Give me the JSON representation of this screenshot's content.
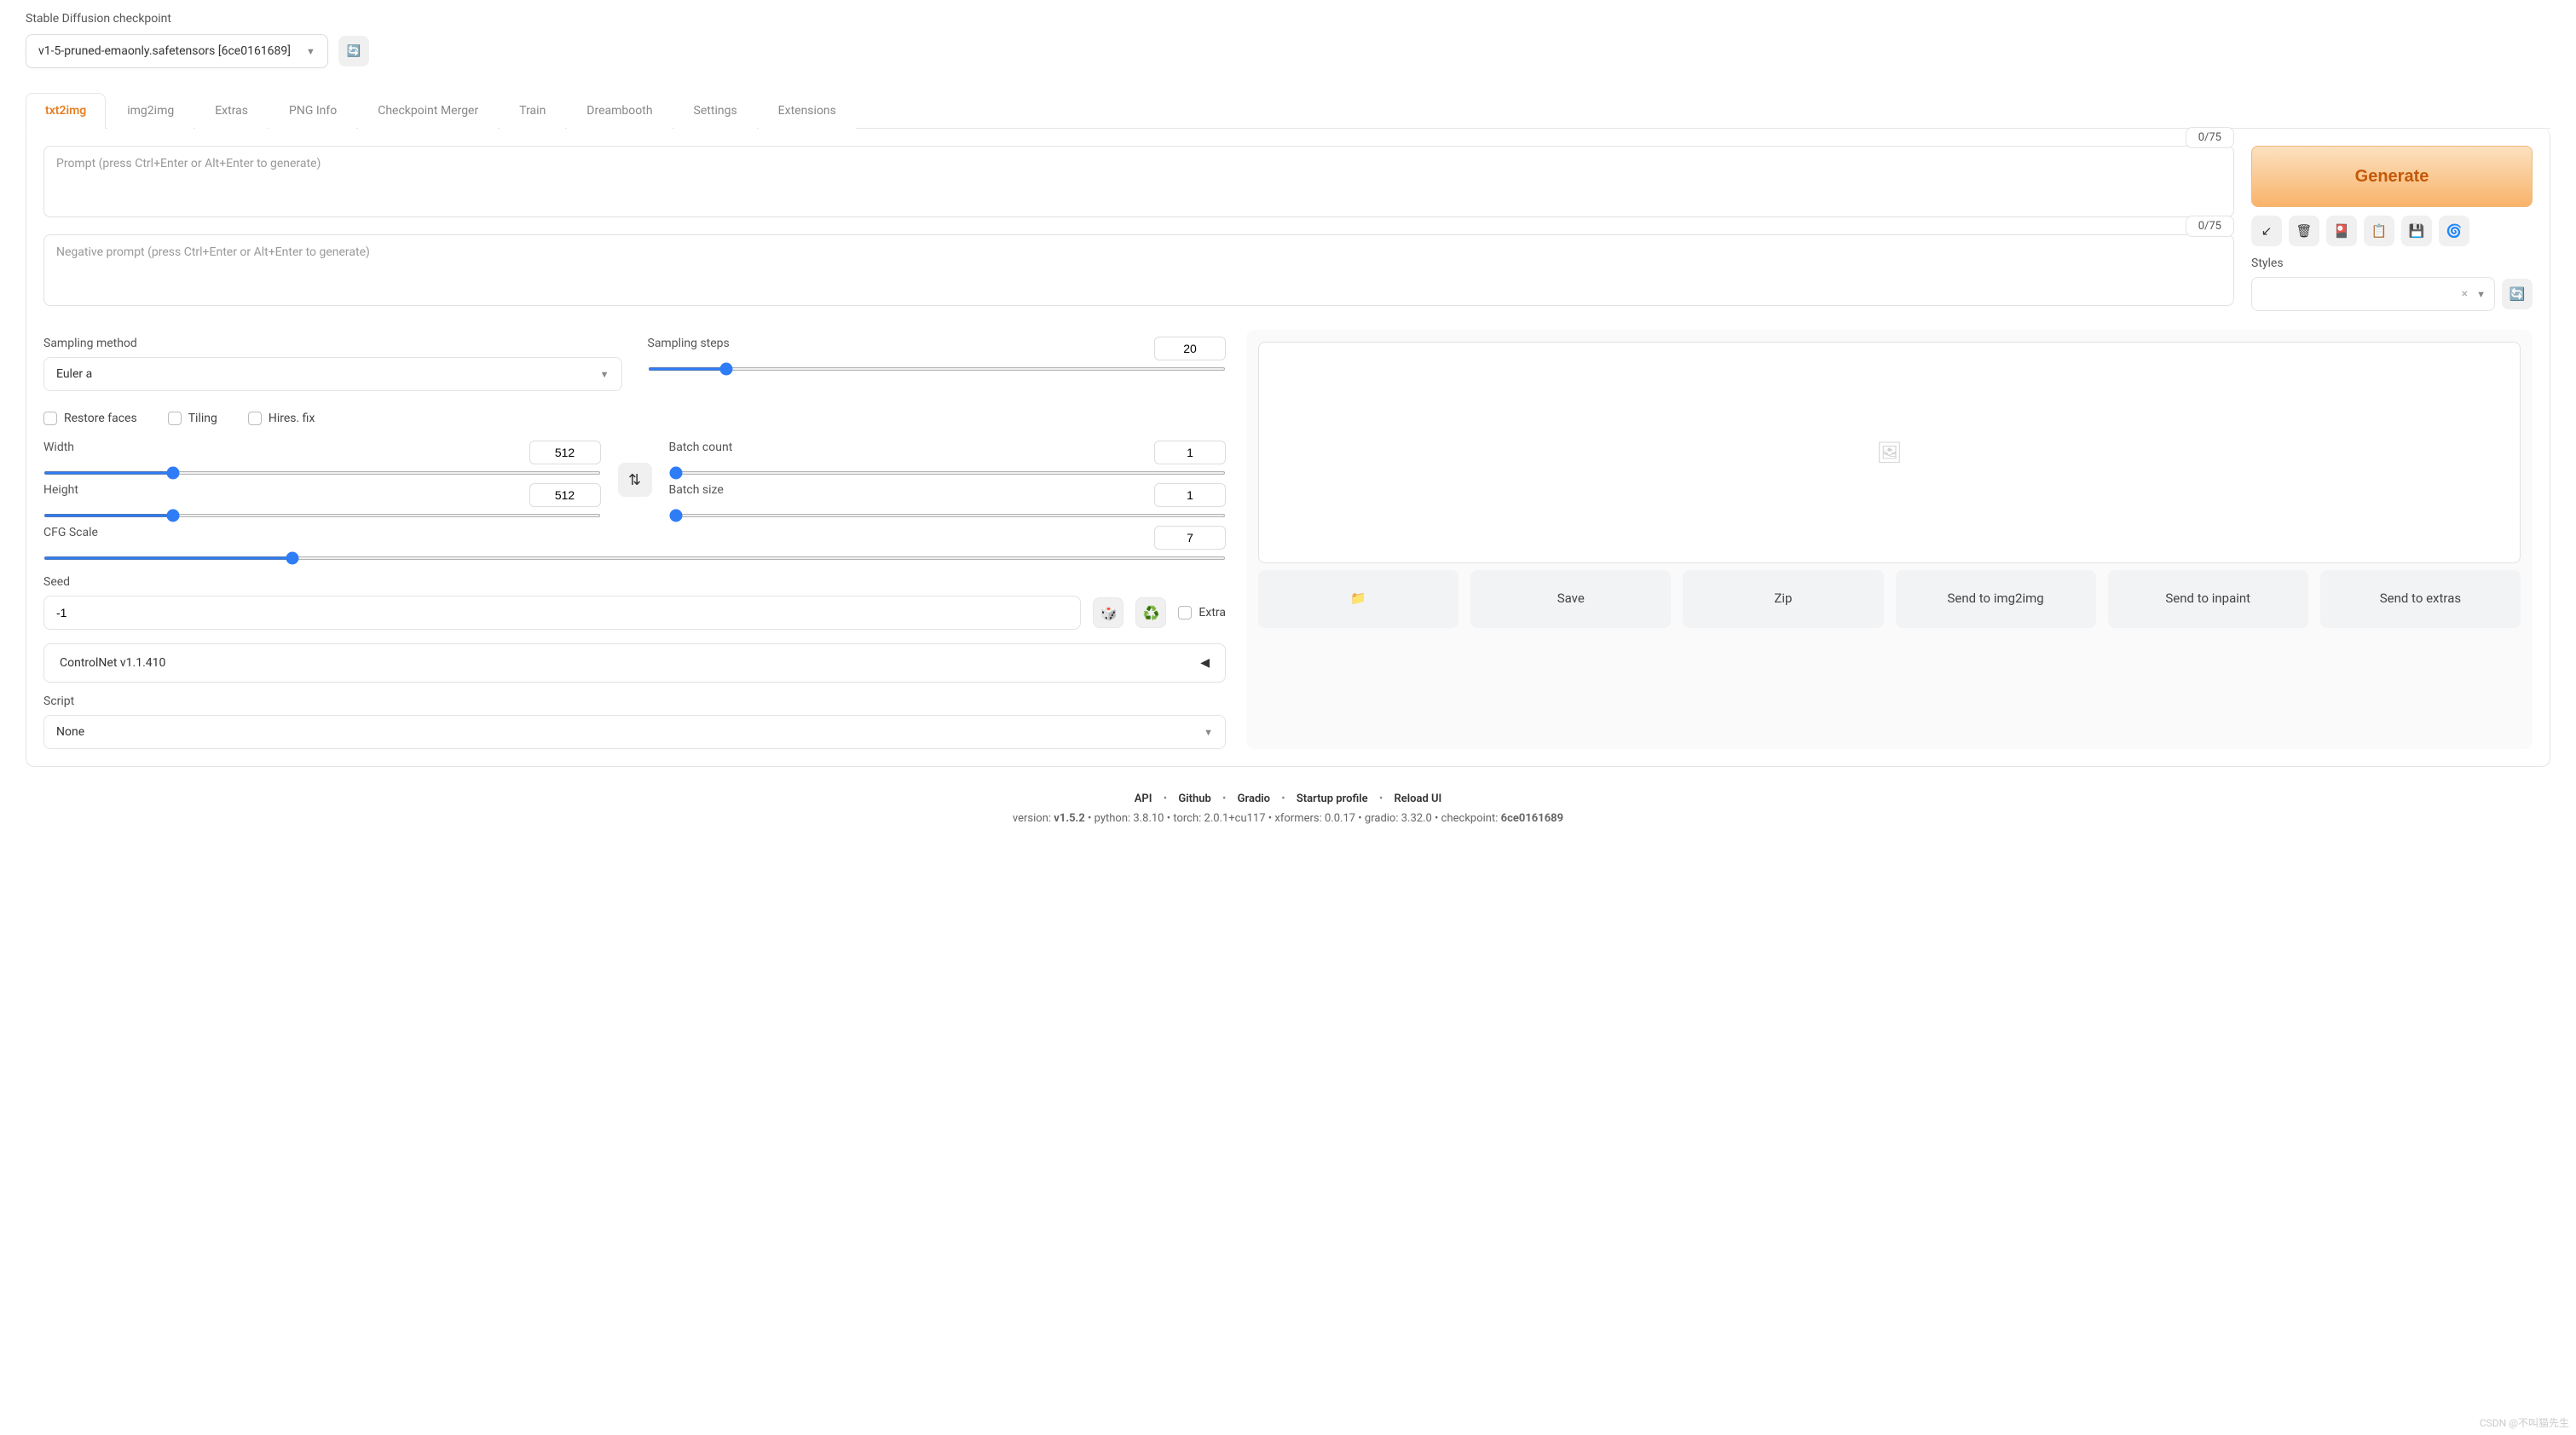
{
  "checkpoint": {
    "label": "Stable Diffusion checkpoint",
    "value": "v1-5-pruned-emaonly.safetensors [6ce0161689]"
  },
  "tabs": {
    "items": [
      "txt2img",
      "img2img",
      "Extras",
      "PNG Info",
      "Checkpoint Merger",
      "Train",
      "Dreambooth",
      "Settings",
      "Extensions"
    ],
    "active": 0
  },
  "prompt": {
    "placeholder": "Prompt (press Ctrl+Enter or Alt+Enter to generate)",
    "counter": "0/75"
  },
  "neg_prompt": {
    "placeholder": "Negative prompt (press Ctrl+Enter or Alt+Enter to generate)",
    "counter": "0/75"
  },
  "generate": {
    "label": "Generate"
  },
  "styles": {
    "label": "Styles",
    "clear": "×"
  },
  "sampling": {
    "method_label": "Sampling method",
    "method_value": "Euler a",
    "steps_label": "Sampling steps",
    "steps_value": "20",
    "steps_min": 1,
    "steps_max": 150
  },
  "checks": {
    "restore": "Restore faces",
    "tiling": "Tiling",
    "hires": "Hires. fix"
  },
  "dims": {
    "width_label": "Width",
    "width_value": "512",
    "height_label": "Height",
    "height_value": "512",
    "min": 64,
    "max": 2048,
    "swap": "⇅"
  },
  "batch": {
    "count_label": "Batch count",
    "count_value": "1",
    "size_label": "Batch size",
    "size_value": "1",
    "min": 1,
    "max": 100
  },
  "cfg": {
    "label": "CFG Scale",
    "value": "7",
    "min": 1,
    "max": 30
  },
  "seed": {
    "label": "Seed",
    "value": "-1",
    "dice": "🎲",
    "recycle": "♻️",
    "extra_label": "Extra"
  },
  "controlnet": {
    "title": "ControlNet v1.1.410",
    "arrow": "◀"
  },
  "script": {
    "label": "Script",
    "value": "None"
  },
  "output_buttons": {
    "folder": "📁",
    "save": "Save",
    "zip": "Zip",
    "send_img2img": "Send to img2img",
    "send_inpaint": "Send to inpaint",
    "send_extras": "Send to extras"
  },
  "icons": {
    "paste": "↙",
    "trash": "🗑",
    "card": "🎴",
    "clipboard": "📋",
    "save": "💾",
    "spiral": "🌀",
    "refresh": "🔄",
    "image_placeholder": "🖼"
  },
  "footer": {
    "links": {
      "api": "API",
      "github": "Github",
      "gradio": "Gradio",
      "startup": "Startup profile",
      "reload": "Reload UI",
      "sep": "•"
    },
    "ver": {
      "prefix": "version: ",
      "version": "v1.5.2",
      "python": "python: 3.8.10",
      "torch": "torch: 2.0.1+cu117",
      "xformers": "xformers: 0.0.17",
      "gradio": "gradio: 3.32.0",
      "checkpoint_label": "checkpoint: ",
      "checkpoint": "6ce0161689",
      "sep": "  •  "
    }
  },
  "watermark": "CSDN @不叫猫先生"
}
